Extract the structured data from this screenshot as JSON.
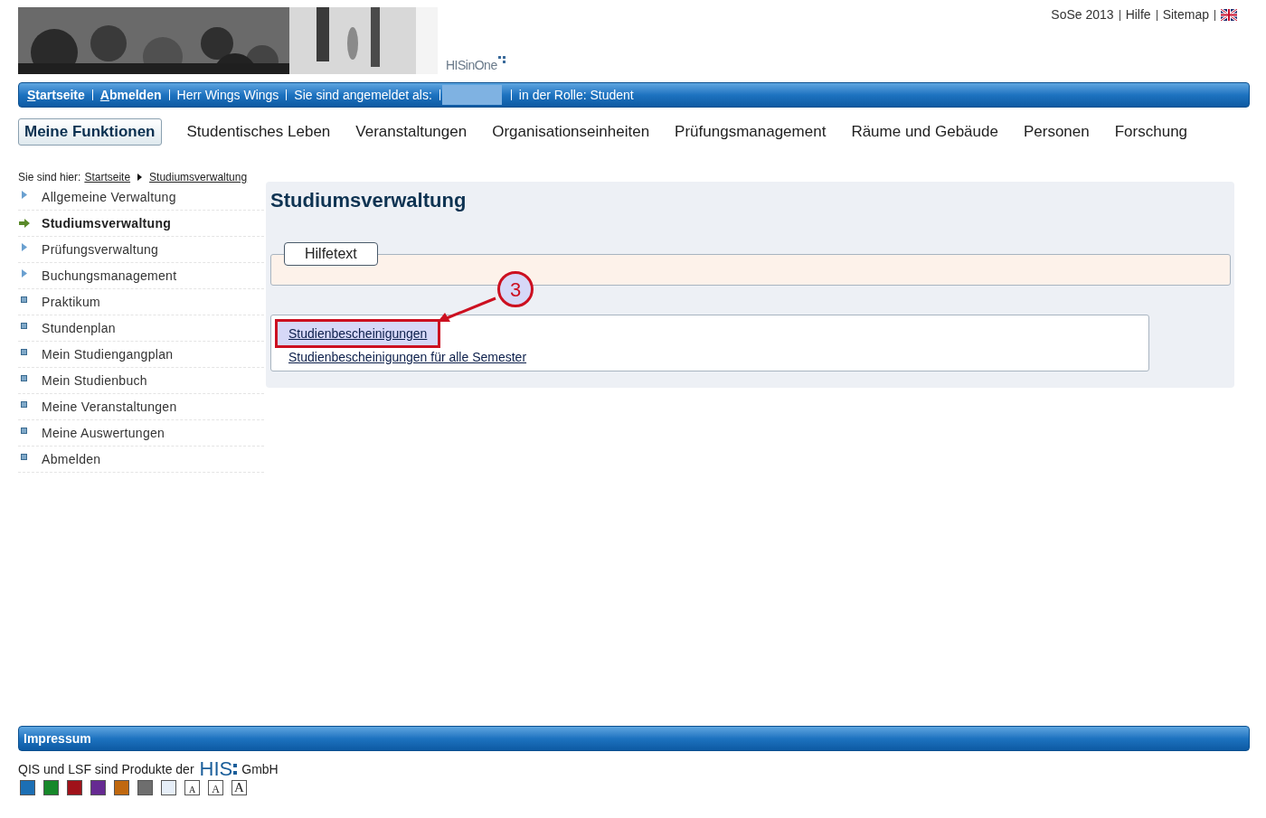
{
  "header": {
    "logo": "HISinOne",
    "top_links": [
      {
        "label": "SoSe 2013",
        "kind": "text"
      },
      {
        "label": "Hilfe",
        "kind": "link"
      },
      {
        "label": "Sitemap",
        "kind": "link"
      },
      {
        "kind": "flag"
      }
    ]
  },
  "user_bar": [
    {
      "kind": "accesskey",
      "label": "Startseite"
    },
    {
      "kind": "accesskey",
      "label": "Abmelden"
    },
    {
      "kind": "text",
      "label": "Herr Wings Wings"
    },
    {
      "kind": "text",
      "label": "Sie sind angemeldet als:"
    },
    {
      "kind": "redacted"
    },
    {
      "kind": "text",
      "label": "in der Rolle: Student"
    }
  ],
  "main_nav": [
    {
      "label": "Meine Funktionen",
      "selected": true
    },
    {
      "label": "Studentisches Leben",
      "selected": false
    },
    {
      "label": "Veranstaltungen",
      "selected": false
    },
    {
      "label": "Organisationseinheiten",
      "selected": false
    },
    {
      "label": "Prüfungsmanagement",
      "selected": false
    },
    {
      "label": "Räume und Gebäude",
      "selected": false
    },
    {
      "label": "Personen",
      "selected": false
    },
    {
      "label": "Forschung",
      "selected": false
    }
  ],
  "breadcrumb": {
    "label": "Sie sind hier:",
    "items": [
      "Startseite",
      "Studiumsverwaltung"
    ]
  },
  "sidebar": {
    "items": [
      {
        "label": "Allgemeine Verwaltung",
        "kind": "folder",
        "selected": false
      },
      {
        "label": "Studiumsverwaltung",
        "kind": "folder",
        "selected": true
      },
      {
        "label": "Prüfungsverwaltung",
        "kind": "folder",
        "selected": false
      },
      {
        "label": "Buchungsmanagement",
        "kind": "folder",
        "selected": false
      },
      {
        "label": "Praktikum",
        "kind": "page",
        "selected": false
      },
      {
        "label": "Stundenplan",
        "kind": "page",
        "selected": false
      },
      {
        "label": "Mein Studiengangplan",
        "kind": "page",
        "selected": false
      },
      {
        "label": "Mein Studienbuch",
        "kind": "page",
        "selected": false
      },
      {
        "label": "Meine Veranstaltungen",
        "kind": "page",
        "selected": false
      },
      {
        "label": "Meine Auswertungen",
        "kind": "page",
        "selected": false
      },
      {
        "label": "Abmelden",
        "kind": "page",
        "selected": false
      }
    ]
  },
  "content": {
    "title": "Studiumsverwaltung",
    "help_box": {
      "legend": "Hilfetext"
    },
    "links": [
      {
        "label": "Studienbescheinigungen",
        "highlighted": true
      },
      {
        "label": "Studienbescheinigungen für alle Semester",
        "highlighted": false
      }
    ],
    "annotation": {
      "number": "3"
    }
  },
  "footer": {
    "bar": "Impressum",
    "text": "QIS und LSF sind Produkte der",
    "logo": "HIS",
    "company": "GmbH",
    "color_themes": [
      {
        "color": "#1c6fb4"
      },
      {
        "color": "#17882a"
      },
      {
        "color": "#a0121a"
      },
      {
        "color": "#662a92"
      },
      {
        "color": "#c0680f"
      },
      {
        "color": "#6e6e6e"
      },
      {
        "color": "#e6eef8"
      }
    ],
    "font_sizes": [
      {
        "label": "A",
        "kind": "small"
      },
      {
        "label": "A",
        "kind": "medium"
      },
      {
        "label": "A",
        "kind": "large"
      }
    ]
  }
}
